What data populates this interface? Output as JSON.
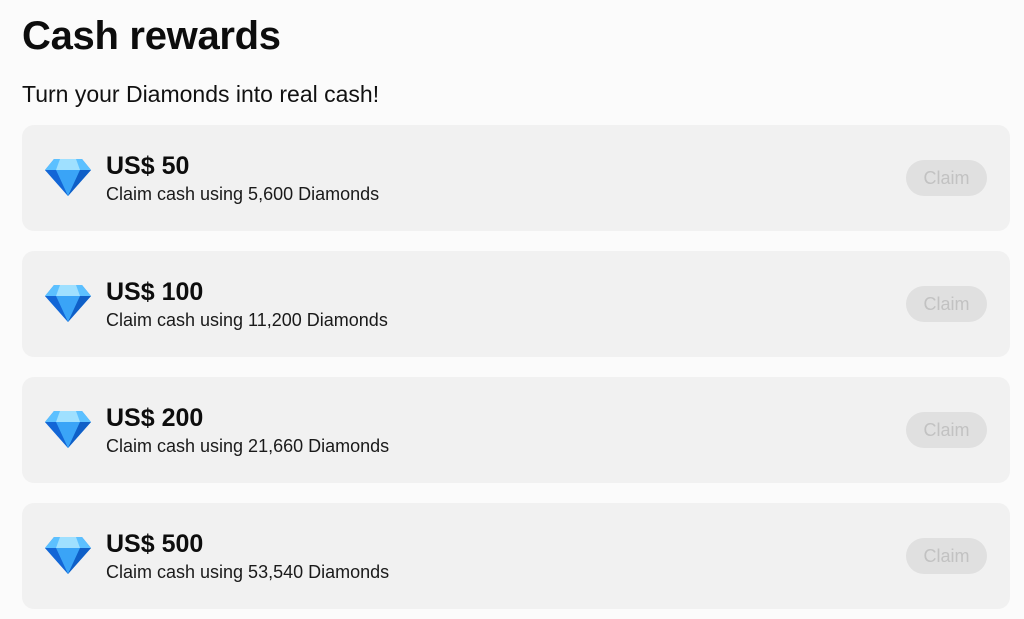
{
  "header": {
    "title": "Cash rewards",
    "subtitle": "Turn your Diamonds into real cash!"
  },
  "rewards": [
    {
      "amount": "US$ 50",
      "description": "Claim cash using 5,600 Diamonds",
      "button": "Claim",
      "icon": "diamond-icon"
    },
    {
      "amount": "US$ 100",
      "description": "Claim cash using 11,200 Diamonds",
      "button": "Claim",
      "icon": "diamond-icon"
    },
    {
      "amount": "US$ 200",
      "description": "Claim cash using 21,660 Diamonds",
      "button": "Claim",
      "icon": "diamond-icon"
    },
    {
      "amount": "US$ 500",
      "description": "Claim cash using 53,540 Diamonds",
      "button": "Claim",
      "icon": "diamond-icon"
    }
  ],
  "colors": {
    "card_background": "#f1f1f1",
    "button_disabled_bg": "#e0e0e0",
    "button_disabled_text": "#c2c2c2",
    "diamond_blue": "#1e90ff"
  }
}
